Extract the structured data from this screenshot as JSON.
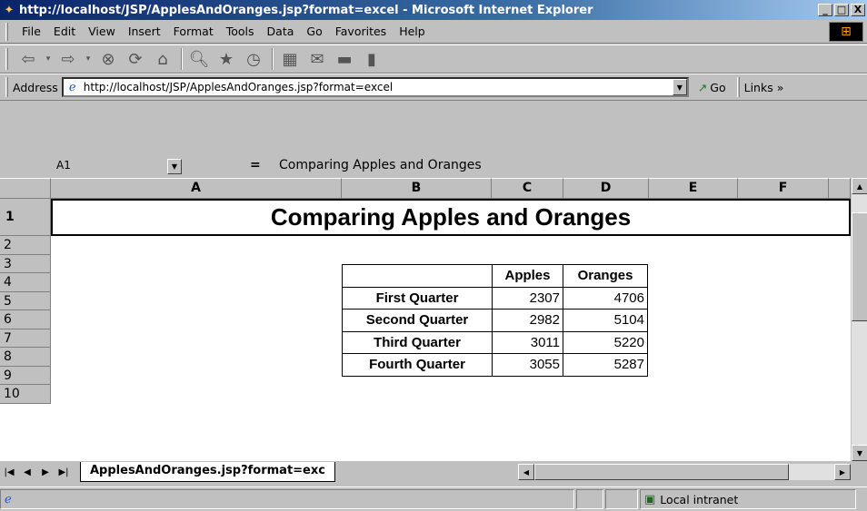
{
  "window": {
    "title": "http://localhost/JSP/ApplesAndOranges.jsp?format=excel - Microsoft Internet Explorer",
    "minimize": "_",
    "maximize": "□",
    "close": "X"
  },
  "menu": [
    "File",
    "Edit",
    "View",
    "Insert",
    "Format",
    "Tools",
    "Data",
    "Go",
    "Favorites",
    "Help"
  ],
  "address": {
    "label": "Address",
    "url": "http://localhost/JSP/ApplesAndOranges.jsp?format=excel",
    "go_label": "Go",
    "links_label": "Links »"
  },
  "formula_bar": {
    "cell_ref": "A1",
    "equals": "=",
    "content": "Comparing Apples and Oranges"
  },
  "columns": [
    "A",
    "B",
    "C",
    "D",
    "E",
    "F"
  ],
  "rows": [
    "1",
    "2",
    "3",
    "4",
    "5",
    "6",
    "7",
    "8",
    "9",
    "10"
  ],
  "sheet": {
    "banner_title": "Comparing Apples and Oranges",
    "table": {
      "headers": [
        "",
        "Apples",
        "Oranges"
      ],
      "rows": [
        {
          "label": "First Quarter",
          "apples": "2307",
          "oranges": "4706"
        },
        {
          "label": "Second Quarter",
          "apples": "2982",
          "oranges": "5104"
        },
        {
          "label": "Third Quarter",
          "apples": "3011",
          "oranges": "5220"
        },
        {
          "label": "Fourth Quarter",
          "apples": "3055",
          "oranges": "5287"
        }
      ]
    }
  },
  "tabs": {
    "active": "ApplesAndOranges.jsp?format=exc"
  },
  "status": {
    "zone": "Local intranet"
  }
}
